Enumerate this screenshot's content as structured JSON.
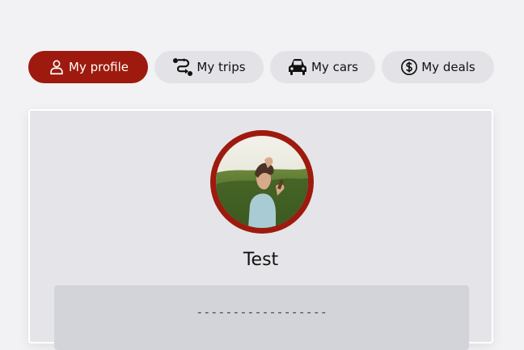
{
  "tabs": [
    {
      "label": "My profile",
      "icon": "user-icon",
      "active": true
    },
    {
      "label": "My trips",
      "icon": "route-icon",
      "active": false
    },
    {
      "label": "My cars",
      "icon": "car-icon",
      "active": false
    },
    {
      "label": "My deals",
      "icon": "dollar-circle-icon",
      "active": false
    }
  ],
  "profile": {
    "name": "Test",
    "details_placeholder": "------------------"
  },
  "colors": {
    "accent": "#9e1a0e",
    "background": "#f2f2f4",
    "tab_inactive": "#e3e3e7",
    "card": "#e5e5e9",
    "info_box": "#d3d4d9"
  }
}
